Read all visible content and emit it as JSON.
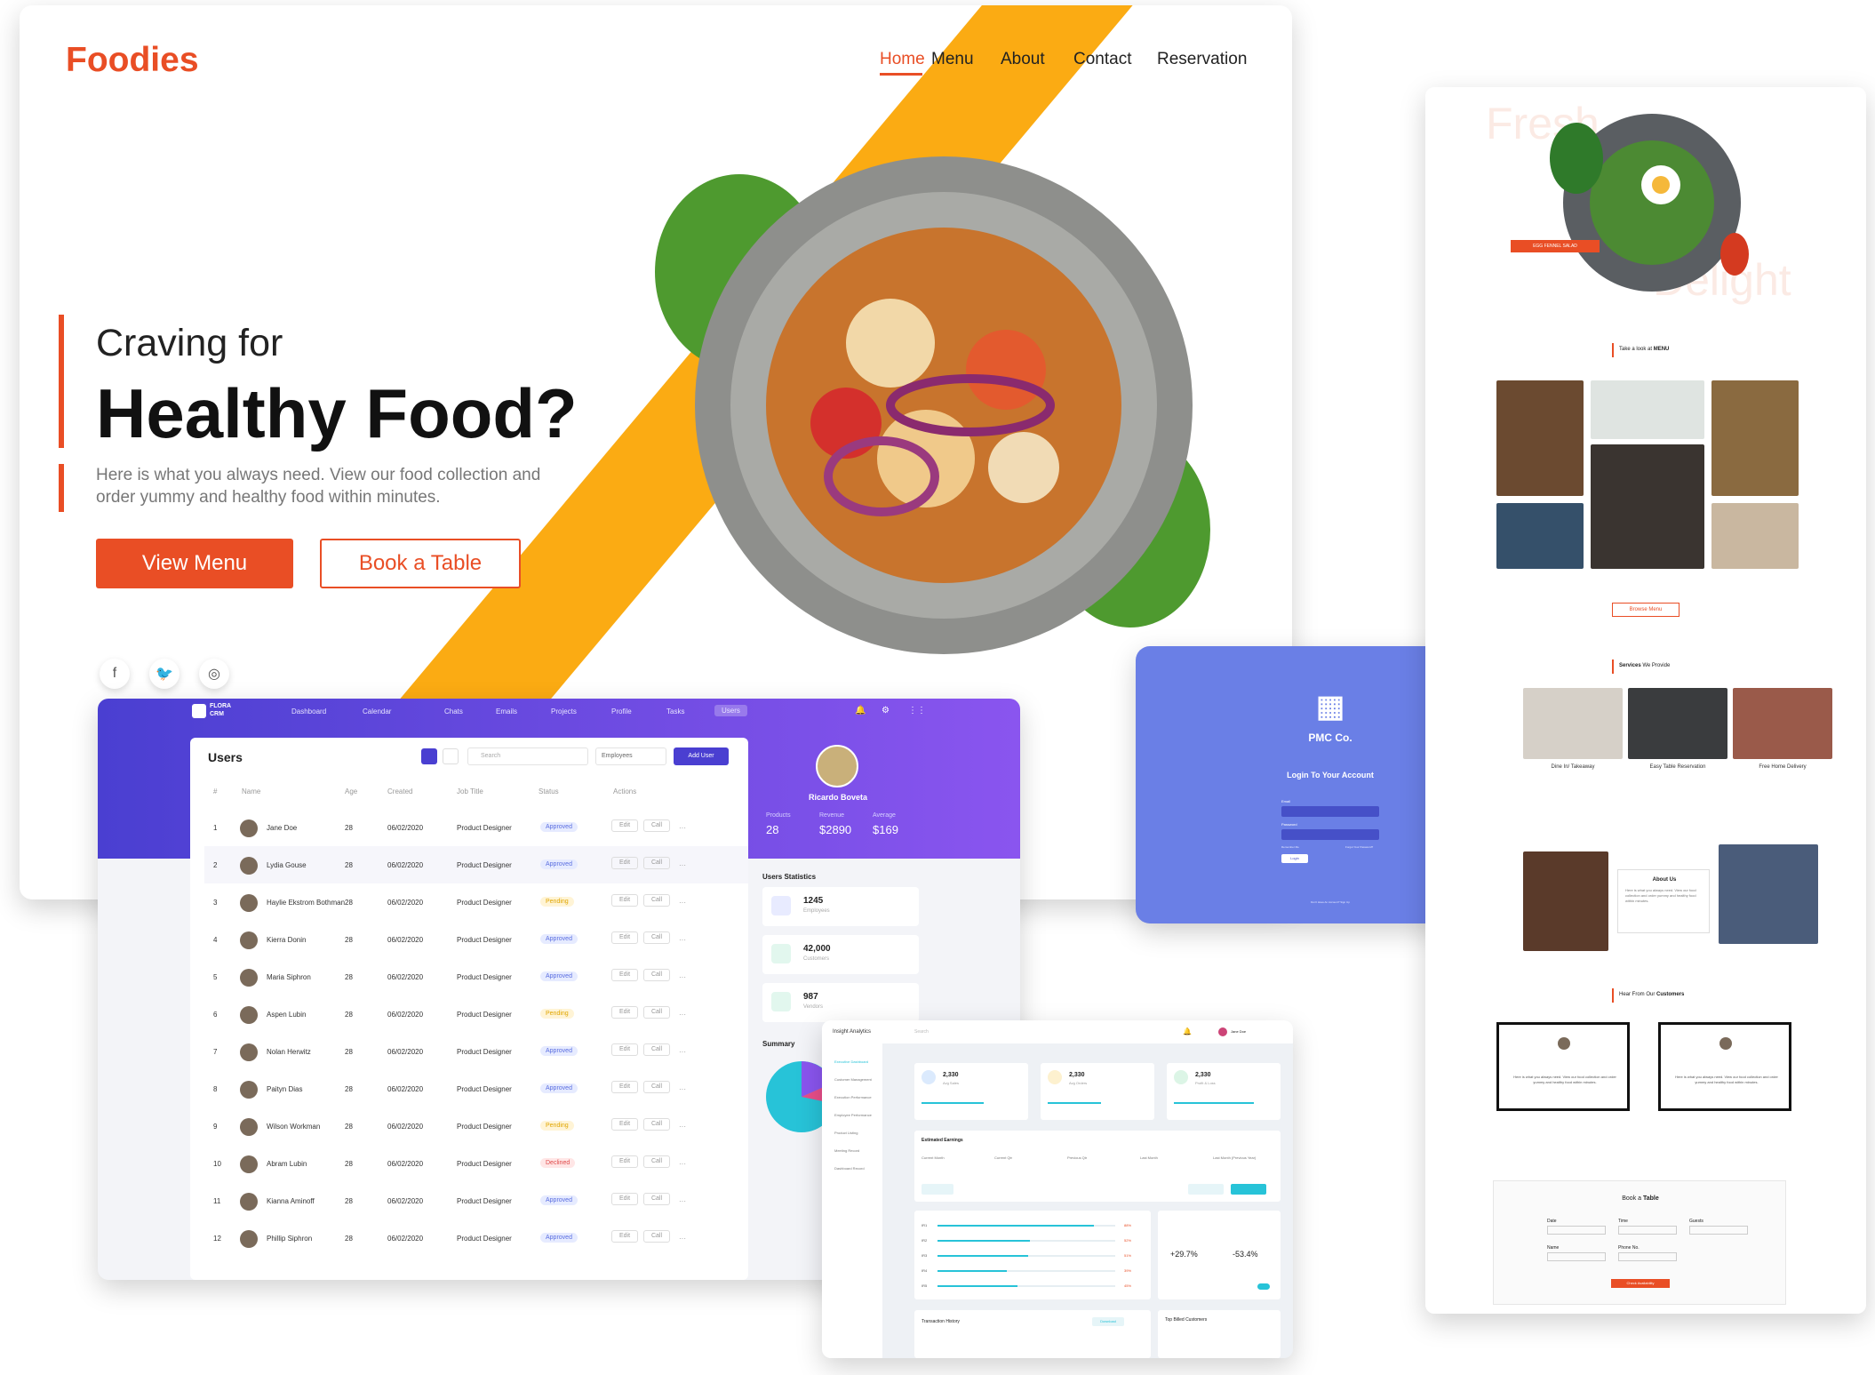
{
  "hero": {
    "logo": "Foodies",
    "nav": [
      "Home",
      "Menu",
      "About",
      "Contact",
      "Reservation"
    ],
    "subtitle": "Craving for",
    "title": "Healthy Food?",
    "description": "Here is what you always need. View our food collection and order yummy and healthy food within minutes.",
    "primary_button": "View Menu",
    "secondary_button": "Book a Table",
    "social_icons": [
      "facebook-icon",
      "twitter-icon",
      "instagram-icon"
    ],
    "colors": {
      "brand": "#e94e25",
      "stripe": "#fbab13"
    }
  },
  "crm": {
    "logo_line1": "FLORA",
    "logo_line2": "CRM",
    "nav": [
      "Dashboard",
      "Calendar",
      "Chats",
      "Emails",
      "Projects",
      "Profile",
      "Tasks",
      "Users"
    ],
    "panel_title": "Users",
    "search_placeholder": "Search",
    "filter": "Employees",
    "add_button": "Add User",
    "columns": [
      "#",
      "Name",
      "Age",
      "Created",
      "Job Title",
      "Status",
      "Actions"
    ],
    "rows": [
      {
        "n": "1",
        "name": "Jane Doe",
        "age": "28",
        "created": "06/02/2020",
        "job": "Product Designer",
        "status": "Approved"
      },
      {
        "n": "2",
        "name": "Lydia Gouse",
        "age": "28",
        "created": "06/02/2020",
        "job": "Product Designer",
        "status": "Approved"
      },
      {
        "n": "3",
        "name": "Haylie Ekstrom Bothman",
        "age": "28",
        "created": "06/02/2020",
        "job": "Product Designer",
        "status": "Pending"
      },
      {
        "n": "4",
        "name": "Kierra Donin",
        "age": "28",
        "created": "06/02/2020",
        "job": "Product Designer",
        "status": "Approved"
      },
      {
        "n": "5",
        "name": "Maria Siphron",
        "age": "28",
        "created": "06/02/2020",
        "job": "Product Designer",
        "status": "Approved"
      },
      {
        "n": "6",
        "name": "Aspen Lubin",
        "age": "28",
        "created": "06/02/2020",
        "job": "Product Designer",
        "status": "Pending"
      },
      {
        "n": "7",
        "name": "Nolan Herwitz",
        "age": "28",
        "created": "06/02/2020",
        "job": "Product Designer",
        "status": "Approved"
      },
      {
        "n": "8",
        "name": "Paityn Dias",
        "age": "28",
        "created": "06/02/2020",
        "job": "Product Designer",
        "status": "Approved"
      },
      {
        "n": "9",
        "name": "Wilson Workman",
        "age": "28",
        "created": "06/02/2020",
        "job": "Product Designer",
        "status": "Pending"
      },
      {
        "n": "10",
        "name": "Abram Lubin",
        "age": "28",
        "created": "06/02/2020",
        "job": "Product Designer",
        "status": "Declined"
      },
      {
        "n": "11",
        "name": "Kianna Aminoff",
        "age": "28",
        "created": "06/02/2020",
        "job": "Product Designer",
        "status": "Approved"
      },
      {
        "n": "12",
        "name": "Phillip Siphron",
        "age": "28",
        "created": "06/02/2020",
        "job": "Product Designer",
        "status": "Approved"
      }
    ],
    "edit_label": "Edit",
    "call_label": "Call",
    "more_label": "···",
    "profile": {
      "name": "Ricardo Boveta",
      "products_label": "Products",
      "products": "28",
      "revenue_label": "Revenue",
      "revenue": "$2890",
      "average_label": "Average",
      "average": "$169"
    },
    "stats_title": "Users Statistics",
    "stats": [
      {
        "value": "1245",
        "label": "Employees"
      },
      {
        "value": "42,000",
        "label": "Customers"
      },
      {
        "value": "987",
        "label": "Vendors"
      }
    ],
    "summary_title": "Summary"
  },
  "pmc": {
    "brand": "PMC Co.",
    "heading": "Login To Your Account",
    "email_label": "Email",
    "password_label": "Password",
    "remember": "Remember Me",
    "forgot": "Forgot Your Password?",
    "login": "Login",
    "signup": "Don't Have An Account? Sign Up",
    "colors": {
      "bg": "#6a7fe6",
      "field": "#4650c8"
    }
  },
  "analytics": {
    "brand": "Insight Analytics",
    "search_placeholder": "Search",
    "user": "Jane Doe",
    "sidebar": [
      "Executive Dashboard",
      "Customer Management",
      "Execution Performance",
      "Employee Performance",
      "Product Listing",
      "Meeting Record",
      "Dashboard Record"
    ],
    "kpis": [
      {
        "value": "2,330",
        "label": "Avg Sales"
      },
      {
        "value": "2,330",
        "label": "Avg Orders"
      },
      {
        "value": "2,330",
        "label": "Profit & Loss"
      }
    ],
    "earnings_title": "Estimated Earnings",
    "earnings": [
      "Current Month",
      "Current Qtr",
      "Previous Qtr",
      "Last Month",
      "Last Month (Previous Year)"
    ],
    "percents": [
      "+29.7%",
      "-53.4%"
    ],
    "transaction_title": "Transaction History",
    "top_title": "Top Billed Customers",
    "download": "Download",
    "bar_rows": [
      "IR1",
      "IR2",
      "IR3",
      "IR4",
      "IR5"
    ],
    "bar_values": [
      "88%",
      "52%",
      "51%",
      "39%",
      "45%"
    ]
  },
  "page2": {
    "word1": "Fresh",
    "word2": "Delight",
    "dish_tag": "EGG FENNEL SALAD",
    "menu_heading_a": "Take a look at",
    "menu_heading_b": "MENU",
    "browse": "Browse Menu",
    "services_a": "Services",
    "services_b": "We Provide",
    "services": [
      "Dine In/ Takeaway",
      "Easy Table Reservation",
      "Free Home Delivery"
    ],
    "about": "About Us",
    "about_text": "Here is what you always need. View our food collection and order yummy and healthy food within minutes.",
    "customers_a": "Hear From Our",
    "customers_b": "Customers",
    "testimonial": "Here is what you always need. View our food collection and order yummy and healthy food within minutes.",
    "book_a": "Book a",
    "book_b": "Table",
    "fields": [
      "Date",
      "Time",
      "Guests",
      "Name",
      "Phone No."
    ],
    "check": "Check Availability"
  }
}
